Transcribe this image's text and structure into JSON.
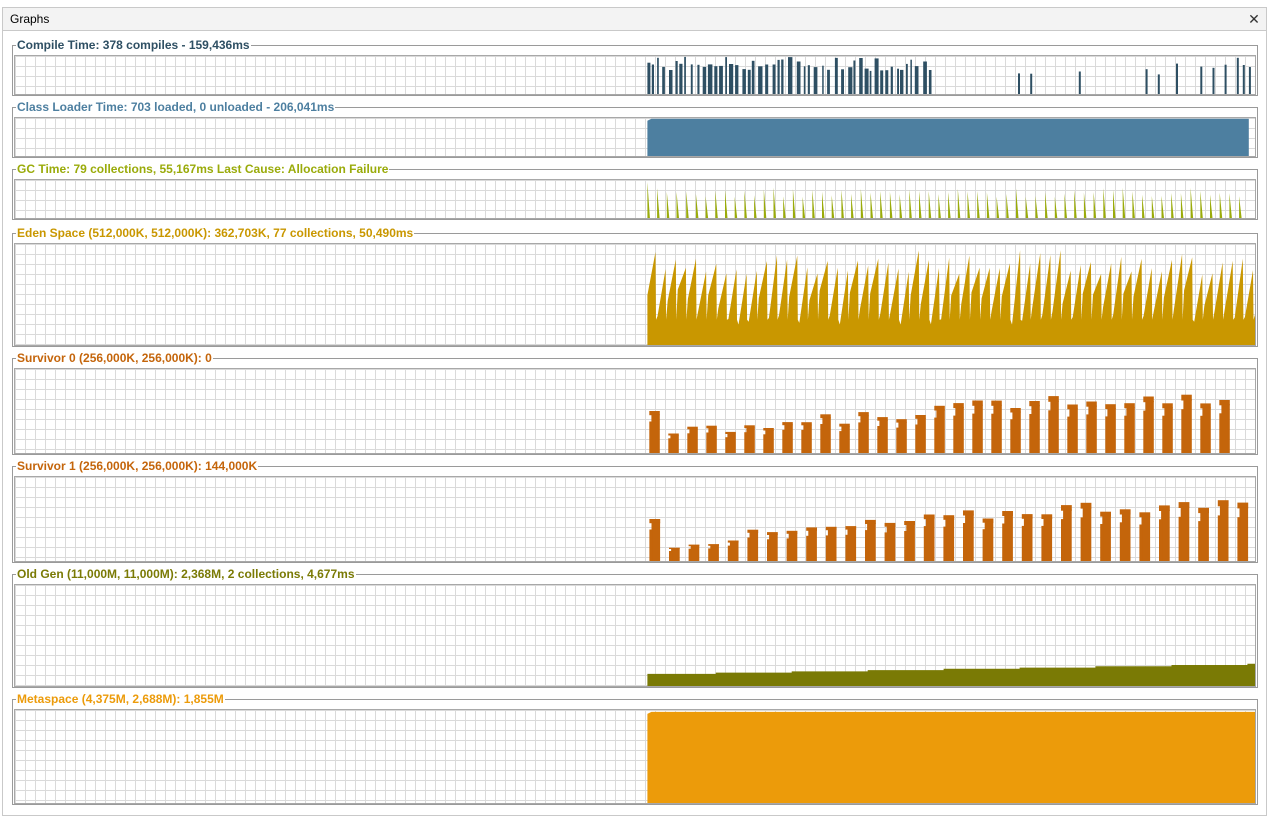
{
  "window": {
    "tab_title": "Graphs",
    "close_glyph": "✕"
  },
  "panels": [
    {
      "id": "compile-time",
      "title": "Compile Time: 378 compiles - 159,436ms",
      "color": "#2e4f63",
      "kind": "spikes",
      "series": {
        "style": "spikes",
        "start": 0.51,
        "end": 1.0,
        "pattern": "dense-then-sparse"
      }
    },
    {
      "id": "class-loader-time",
      "title": "Class Loader Time: 703 loaded, 0 unloaded - 206,041ms",
      "color": "#4d7fa0",
      "kind": "block",
      "series": {
        "style": "plateau",
        "start": 0.51,
        "end": 0.995,
        "level": 0.98
      }
    },
    {
      "id": "gc-time",
      "title": "GC Time: 79 collections, 55,167ms Last Cause: Allocation Failure",
      "color": "#9aab0a",
      "kind": "gc-spikes",
      "series": {
        "style": "spikes",
        "start": 0.51,
        "end": 0.995,
        "count": 79
      }
    },
    {
      "id": "eden-space",
      "title": "Eden Space (512,000K, 512,000K): 362,703K, 77 collections, 50,490ms",
      "color": "#c99700",
      "kind": "sawtooth",
      "series": {
        "style": "sawtooth",
        "start": 0.51,
        "end": 1.0,
        "count": 77
      }
    },
    {
      "id": "survivor-0",
      "title": "Survivor 0 (256,000K, 256,000K): 0",
      "color": "#c4650b",
      "kind": "steps",
      "series": {
        "style": "pulses",
        "start": 0.51,
        "end": 0.985,
        "trend": "rising"
      }
    },
    {
      "id": "survivor-1",
      "title": "Survivor 1 (256,000K, 256,000K): 144,000K",
      "color": "#c4650b",
      "kind": "steps",
      "series": {
        "style": "pulses",
        "start": 0.51,
        "end": 1.0,
        "trend": "rising"
      }
    },
    {
      "id": "old-gen",
      "title": "Old Gen (11,000M, 11,000M): 2,368M, 2 collections, 4,677ms",
      "color": "#7a7a05",
      "kind": "ramp",
      "series": {
        "style": "slow-growth",
        "start": 0.51,
        "end": 1.0,
        "from": 0.12,
        "to": 0.22
      }
    },
    {
      "id": "metaspace",
      "title": "Metaspace (4,375M, 2,688M): 1,855M",
      "color": "#ec9b0a",
      "kind": "block",
      "series": {
        "style": "plateau",
        "start": 0.51,
        "end": 1.0,
        "level": 0.98
      }
    }
  ]
}
